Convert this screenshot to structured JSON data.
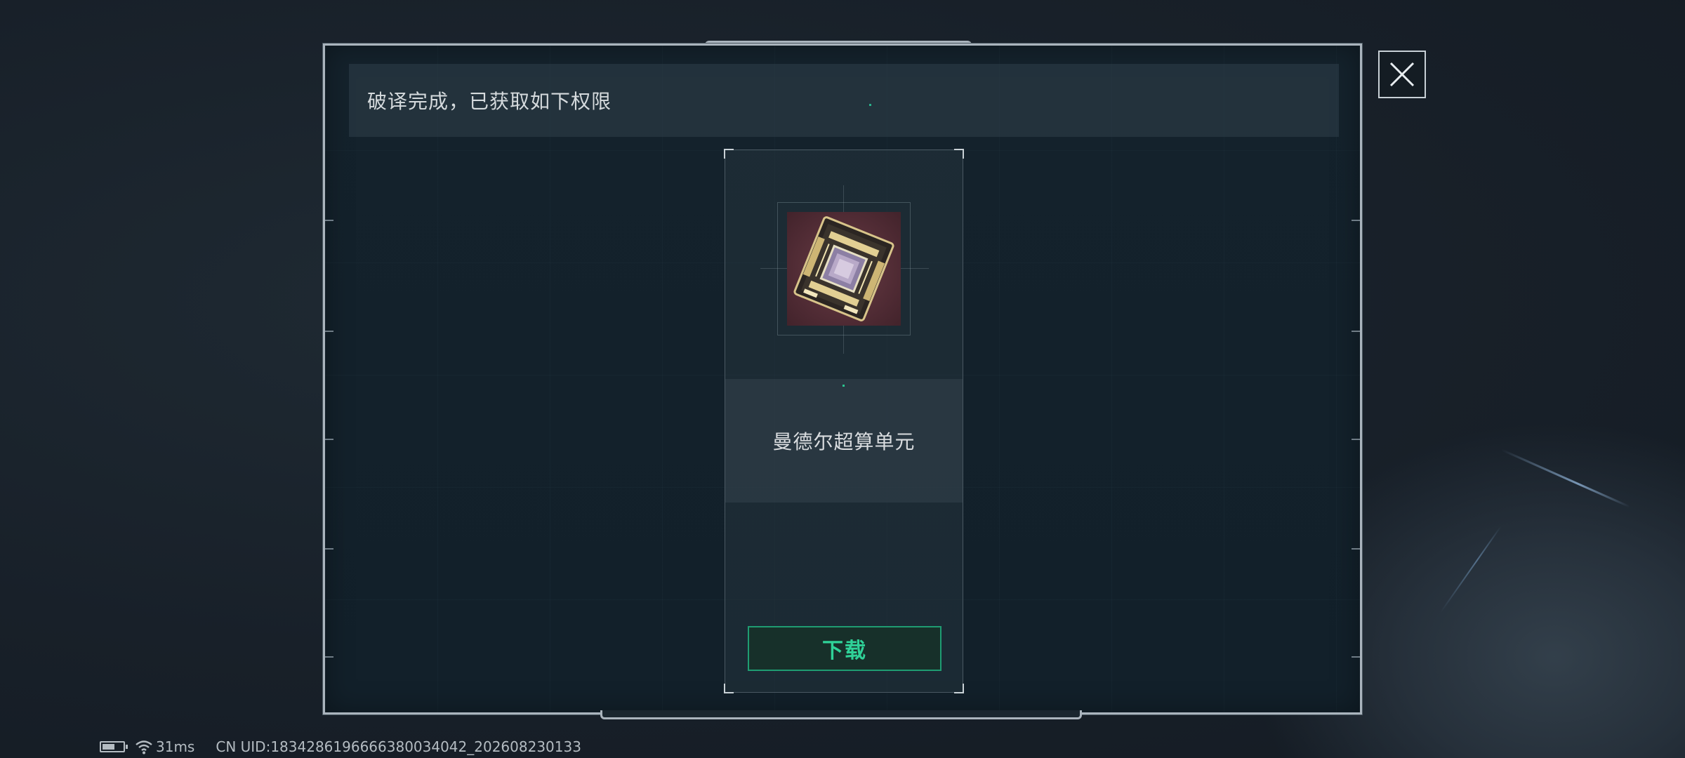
{
  "dialog": {
    "header_text": "破译完成，已获取如下权限"
  },
  "card": {
    "item_name": "曼德尔超算单元",
    "item_icon": "chip-icon",
    "download_label": "下载"
  },
  "close_icon": "close-icon",
  "status_bar": {
    "battery_level": 0.6,
    "ping": "31ms",
    "uid": "CN UID:1834286196666380034042_202608230133"
  }
}
